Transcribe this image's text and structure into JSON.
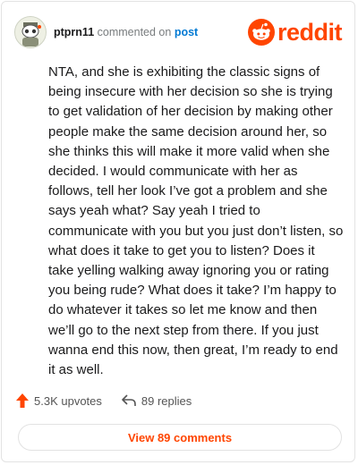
{
  "header": {
    "username": "ptprn11",
    "action_text": "commented on",
    "target_link": "post",
    "logo_text": "reddit",
    "avatar_icon": "snoo-avatar-icon",
    "logo_icon": "reddit-alien-icon"
  },
  "comment": {
    "body": "NTA, and she is exhibiting the classic signs of being insecure with her decision so she is trying to get validation of her decision by making other people make the same decision around her, so she thinks this will make it more valid when she decided. I would communicate with her as follows, tell her look I’ve got a problem and she says yeah what? Say yeah I tried to communicate with you but you just don’t listen, so what does it take to get you to listen? Does it take yelling walking away ignoring you or rating you being rude? What does it take? I’m happy to do whatever it takes so let me know and then we’ll go to the next step from there. If you just wanna end this now, then great, I’m ready to end it as well."
  },
  "actions": {
    "upvotes": "5.3K upvotes",
    "replies": "89 replies"
  },
  "footer": {
    "view_comments": "View 89 comments"
  },
  "colors": {
    "brand": "#ff4500",
    "link": "#0079d3"
  }
}
